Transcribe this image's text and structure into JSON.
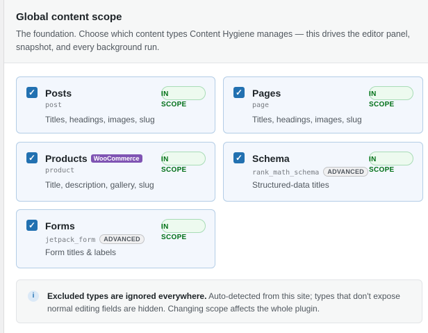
{
  "section": {
    "title": "Global content scope",
    "description": "The foundation. Choose which content types Content Hygiene manages — this drives the editor panel, snapshot, and every background run."
  },
  "cards": [
    {
      "label": "Posts",
      "slug": "post",
      "description": "Titles, headings, images, slug",
      "badge": "",
      "tag": "",
      "checked": true,
      "status": "IN SCOPE"
    },
    {
      "label": "Pages",
      "slug": "page",
      "description": "Titles, headings, images, slug",
      "badge": "",
      "tag": "",
      "checked": true,
      "status": "IN SCOPE"
    },
    {
      "label": "Products",
      "slug": "product",
      "description": "Title, description, gallery, slug",
      "badge": "WooCommerce",
      "tag": "",
      "checked": true,
      "status": "IN SCOPE"
    },
    {
      "label": "Schema",
      "slug": "rank_math_schema",
      "description": "Structured-data titles",
      "badge": "",
      "tag": "ADVANCED",
      "checked": true,
      "status": "IN SCOPE"
    },
    {
      "label": "Forms",
      "slug": "jetpack_form",
      "description": "Form titles & labels",
      "badge": "",
      "tag": "ADVANCED",
      "checked": true,
      "status": "IN SCOPE"
    }
  ],
  "notice": {
    "icon": "info-icon",
    "bold": "Excluded types are ignored everywhere.",
    "text": " Auto-detected from this site; types that don't expose normal editing fields are hidden. Changing scope affects the whole plugin."
  },
  "icons": {
    "checkbox": "checkmark-icon",
    "info": "i"
  },
  "colors": {
    "accent": "#2271b1",
    "scope_green": "#007017",
    "woo_purple": "#7f54b3"
  }
}
